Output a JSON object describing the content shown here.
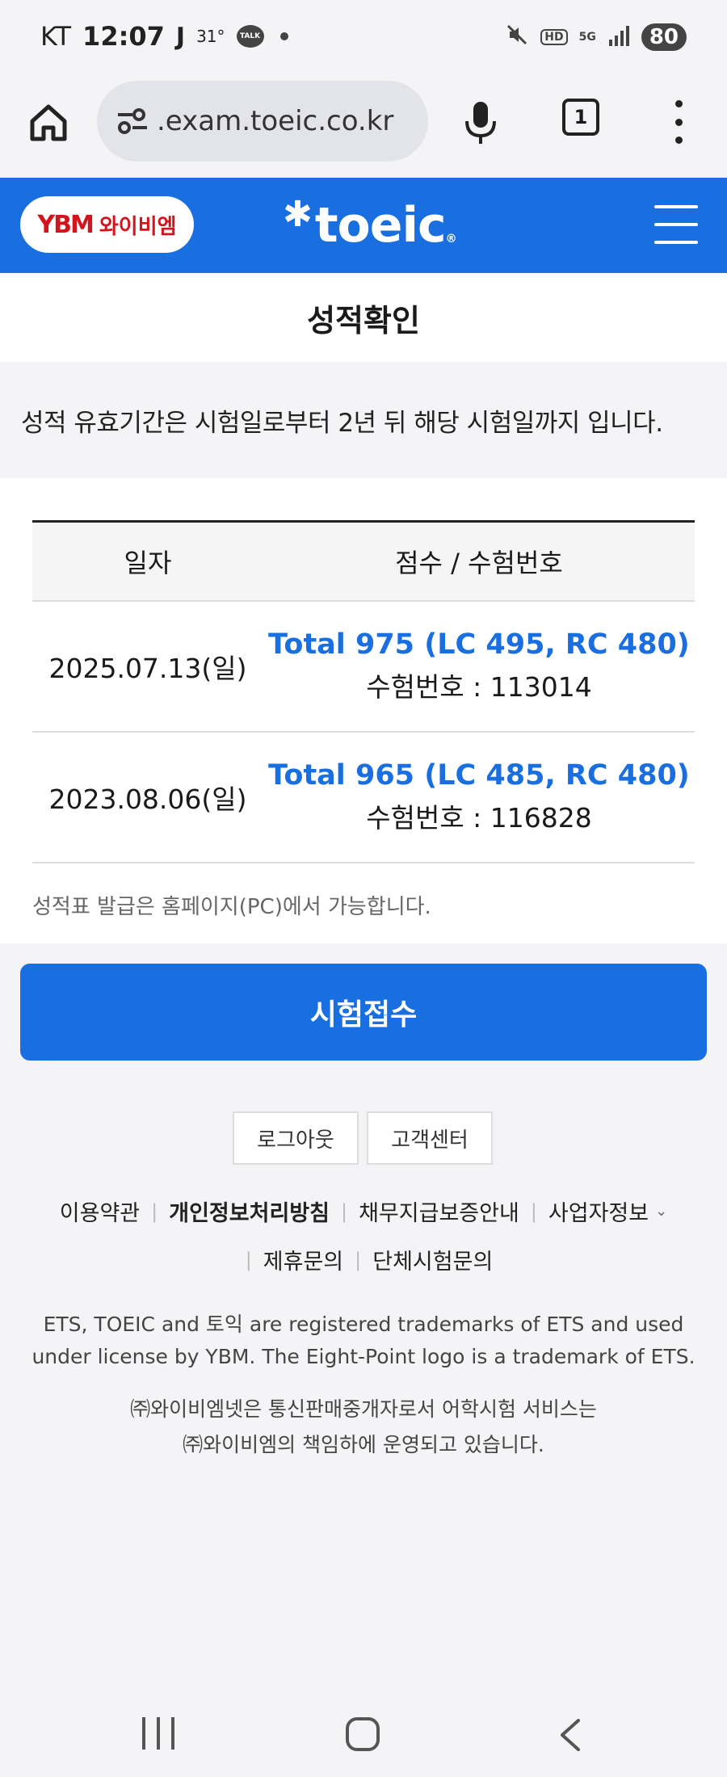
{
  "status_bar": {
    "carrier": "KT",
    "time": "12:07",
    "app_letter": "J",
    "temperature": "31°",
    "talk_badge": "TALK",
    "hd_label": "HD",
    "network": "5G",
    "battery": "80"
  },
  "browser": {
    "url": ".exam.toeic.co.kr",
    "tab_count": "1"
  },
  "site_header": {
    "ybm_mark": "YBM",
    "ybm_text": "와이비엠",
    "toeic_logo": "toeic",
    "toeic_reg": "®"
  },
  "page": {
    "title": "성적확인",
    "notice": "성적 유효기간은 시험일로부터 2년 뒤 해당 시험일까지 입니다."
  },
  "results": {
    "headers": [
      "일자",
      "점수 / 수험번호"
    ],
    "rows": [
      {
        "date": "2025.07.13(일)",
        "score": "Total 975 (LC 495, RC 480)",
        "exam_number": "수험번호 : 113014"
      },
      {
        "date": "2023.08.06(일)",
        "score": "Total 965 (LC 485, RC 480)",
        "exam_number": "수험번호 : 116828"
      }
    ],
    "issue_note": "성적표 발급은 홈페이지(PC)에서 가능합니다."
  },
  "primary_button": "시험접수",
  "small_buttons": [
    "로그아웃",
    "고객센터"
  ],
  "footer": {
    "links_row1": [
      "이용약관",
      "개인정보처리방침",
      "채무지급보증안내",
      "사업자정보"
    ],
    "links_row2": [
      "제휴문의",
      "단체시험문의"
    ],
    "trademark": "ETS, TOEIC and 토익 are registered trademarks of ETS and used under license by YBM. The Eight-Point logo is a trademark of ETS.",
    "company_line1": "㈜와이비엠넷은 통신판매중개자로서 어학시험 서비스는",
    "company_line2": "㈜와이비엠의 책임하에 운영되고 있습니다."
  },
  "colors": {
    "brand_blue": "#1a6fe0",
    "ybm_red": "#d4141c"
  }
}
